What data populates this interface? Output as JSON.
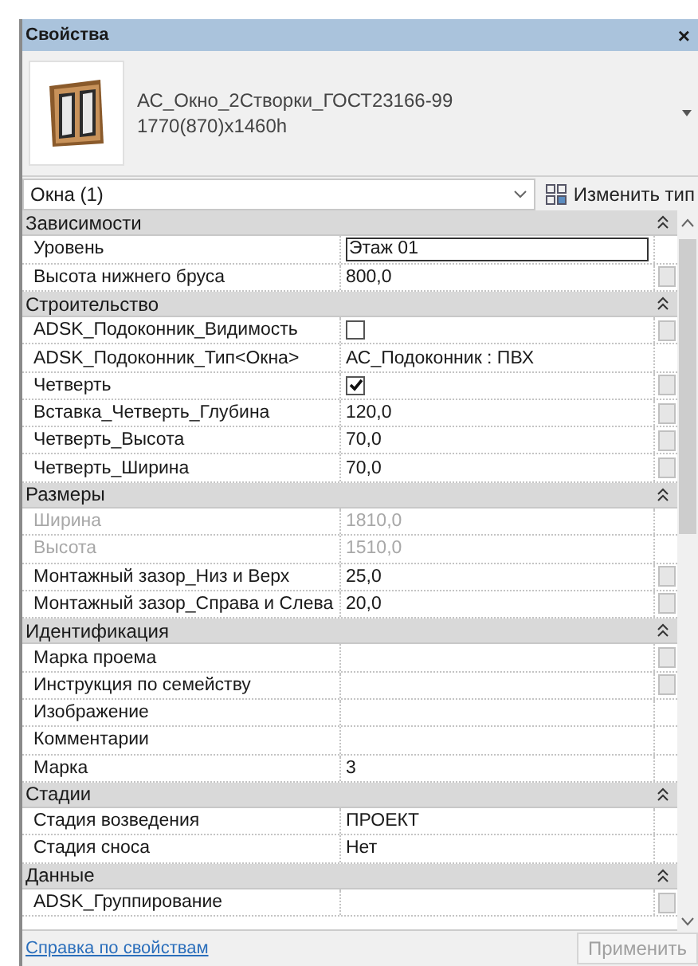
{
  "window": {
    "title": "Свойства",
    "close": "×"
  },
  "type_selector": {
    "name": "АС_Окно_2Створки_ГОСТ23166-99",
    "size": "1770(870)x1460h"
  },
  "filter": {
    "value": "Окна (1)",
    "edit_type_button": "Изменить тип"
  },
  "groups": [
    {
      "title": "Зависимости",
      "expanded": true,
      "rows": [
        {
          "name": "Уровень",
          "value": "Этаж 01",
          "kind": "edit",
          "button": false,
          "disabled": false
        },
        {
          "name": "Высота нижнего бруса",
          "value": "800,0",
          "kind": "text",
          "button": true,
          "disabled": false
        }
      ]
    },
    {
      "title": "Строительство",
      "expanded": true,
      "rows": [
        {
          "name": "ADSK_Подоконник_Видимость",
          "checked": false,
          "kind": "checkbox",
          "button": true,
          "disabled": false
        },
        {
          "name": "ADSK_Подоконник_Тип<Окна>",
          "value": "АС_Подоконник : ПВХ",
          "kind": "text",
          "button": false,
          "disabled": false
        },
        {
          "name": "Четверть",
          "checked": true,
          "kind": "checkbox",
          "button": true,
          "disabled": false
        },
        {
          "name": "Вставка_Четверть_Глубина",
          "value": "120,0",
          "kind": "text",
          "button": true,
          "disabled": false
        },
        {
          "name": "Четверть_Высота",
          "value": "70,0",
          "kind": "text",
          "button": true,
          "disabled": false
        },
        {
          "name": "Четверть_Ширина",
          "value": "70,0",
          "kind": "text",
          "button": true,
          "disabled": false
        }
      ]
    },
    {
      "title": "Размеры",
      "expanded": true,
      "rows": [
        {
          "name": "Ширина",
          "value": "1810,0",
          "kind": "text",
          "button": false,
          "disabled": true
        },
        {
          "name": "Высота",
          "value": "1510,0",
          "kind": "text",
          "button": false,
          "disabled": true
        },
        {
          "name": "Монтажный зазор_Низ и Верх",
          "value": "25,0",
          "kind": "text",
          "button": true,
          "disabled": false
        },
        {
          "name": "Монтажный зазор_Справа и Слева",
          "value": "20,0",
          "kind": "text",
          "button": true,
          "disabled": false
        }
      ]
    },
    {
      "title": "Идентификация",
      "expanded": true,
      "rows": [
        {
          "name": "Марка проема",
          "kind": "text",
          "button": true,
          "disabled": false
        },
        {
          "name": "Инструкция по семейству",
          "kind": "text",
          "button": true,
          "disabled": false
        },
        {
          "name": "Изображение",
          "kind": "text",
          "button": false,
          "disabled": false
        },
        {
          "name": "Комментарии",
          "kind": "text",
          "button": false,
          "disabled": false
        },
        {
          "name": "Марка",
          "value": "3",
          "kind": "text",
          "button": false,
          "disabled": false
        }
      ]
    },
    {
      "title": "Стадии",
      "expanded": true,
      "rows": [
        {
          "name": "Стадия возведения",
          "value": "ПРОЕКТ",
          "kind": "text",
          "button": false,
          "disabled": false
        },
        {
          "name": "Стадия сноса",
          "value": "Нет",
          "kind": "text",
          "button": false,
          "disabled": false
        }
      ]
    },
    {
      "title": "Данные",
      "expanded": true,
      "rows": [
        {
          "name": "ADSK_Группирование",
          "kind": "text",
          "button": true,
          "disabled": false
        }
      ]
    }
  ],
  "footer": {
    "help_link": "Справка по свойствам",
    "apply_button": "Применить",
    "apply_disabled": true
  }
}
